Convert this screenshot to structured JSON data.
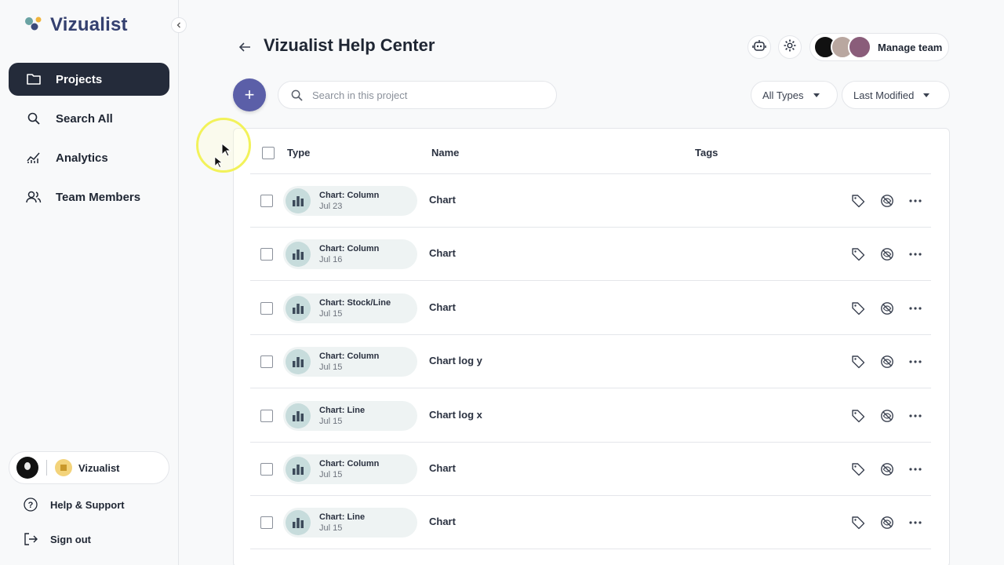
{
  "app": {
    "name": "Vizualist",
    "accent": "#5b5fa8",
    "nav_active_bg": "#242b3a"
  },
  "sidebar": {
    "items": [
      {
        "label": "Projects",
        "icon": "folder-icon",
        "active": true
      },
      {
        "label": "Search All",
        "icon": "search-icon",
        "active": false
      },
      {
        "label": "Analytics",
        "icon": "analytics-icon",
        "active": false
      },
      {
        "label": "Team Members",
        "icon": "team-icon",
        "active": false
      }
    ],
    "workspace": {
      "name": "Vizualist"
    },
    "help_label": "Help & Support",
    "signout_label": "Sign out"
  },
  "header": {
    "title": "Vizualist Help Center",
    "manage_team_label": "Manage team"
  },
  "toolbar": {
    "add_label": "+",
    "search_placeholder": "Search in this project",
    "type_filter": "All Types",
    "sort_filter": "Last Modified"
  },
  "table": {
    "columns": {
      "type": "Type",
      "name": "Name",
      "tags": "Tags"
    },
    "rows": [
      {
        "type": "Chart: Column",
        "date": "Jul 23",
        "name": "Chart"
      },
      {
        "type": "Chart: Column",
        "date": "Jul 16",
        "name": "Chart"
      },
      {
        "type": "Chart: Stock/Line",
        "date": "Jul 15",
        "name": "Chart"
      },
      {
        "type": "Chart: Column",
        "date": "Jul 15",
        "name": "Chart log y"
      },
      {
        "type": "Chart: Line",
        "date": "Jul 15",
        "name": "Chart log x"
      },
      {
        "type": "Chart: Column",
        "date": "Jul 15",
        "name": "Chart"
      },
      {
        "type": "Chart: Line",
        "date": "Jul 15",
        "name": "Chart"
      }
    ]
  }
}
